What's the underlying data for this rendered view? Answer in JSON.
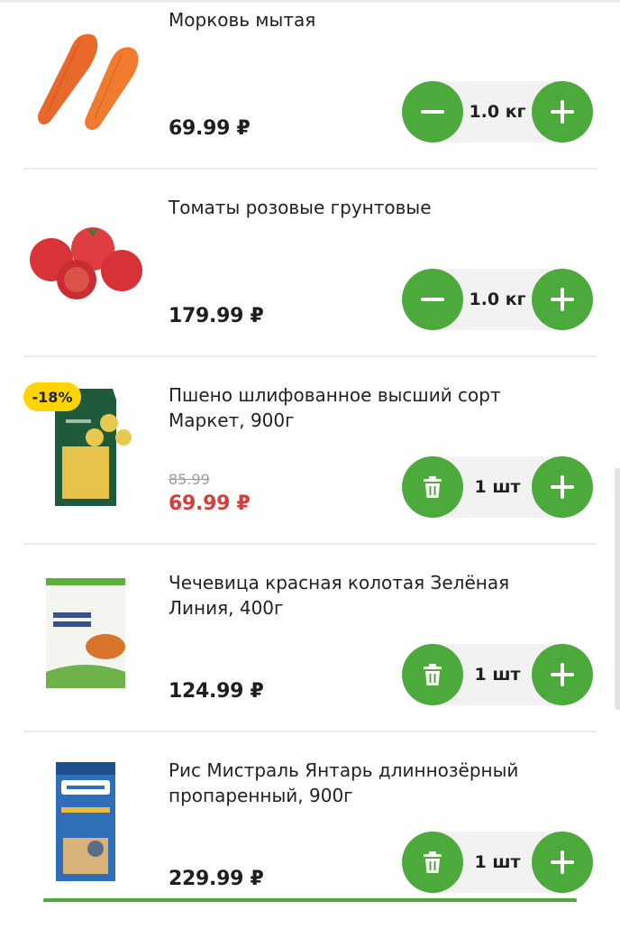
{
  "items": [
    {
      "name": "Морковь мытая",
      "price": "69.99 ₽",
      "quantity": "1.0 кг",
      "left_action": "minus-icon",
      "right_action": "plus-icon"
    },
    {
      "name": "Томаты розовые грунтовые",
      "price": "179.99 ₽",
      "quantity": "1.0 кг",
      "left_action": "minus-icon",
      "right_action": "plus-icon"
    },
    {
      "name": "Пшено шлифованное высший сорт Маркет, 900г",
      "old_price": "85.99",
      "price": "69.99 ₽",
      "discount_badge": "-18%",
      "quantity": "1 шт",
      "left_action": "trash-icon",
      "right_action": "plus-icon"
    },
    {
      "name": "Чечевица красная колотая Зелёная Линия, 400г",
      "price": "124.99 ₽",
      "quantity": "1 шт",
      "left_action": "trash-icon",
      "right_action": "plus-icon"
    },
    {
      "name": "Рис Мистраль Янтарь длиннозёрный пропаренный, 900г",
      "price": "229.99 ₽",
      "quantity": "1 шт",
      "left_action": "trash-icon",
      "right_action": "plus-icon"
    }
  ],
  "colors": {
    "accent_green": "#4caa3c",
    "sale_red": "#d2403b",
    "badge_yellow": "#ffd400",
    "stepper_bg": "#f2f2f2"
  }
}
